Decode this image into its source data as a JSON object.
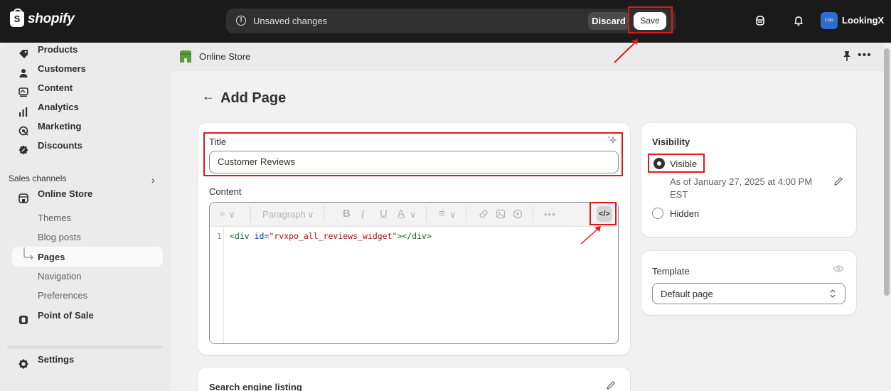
{
  "topbar": {
    "brand": "shopify",
    "brand_glyph": "S",
    "unsaved_icon": "!",
    "unsaved_text": "Unsaved changes",
    "discard_label": "Discard",
    "save_label": "Save",
    "user_initials": "Loo",
    "user_name": "LookingX"
  },
  "sidebar": {
    "items": [
      {
        "label": "Products",
        "icon": "tag-icon"
      },
      {
        "label": "Customers",
        "icon": "person-icon"
      },
      {
        "label": "Content",
        "icon": "content-icon"
      },
      {
        "label": "Analytics",
        "icon": "bar-chart-icon"
      },
      {
        "label": "Marketing",
        "icon": "target-icon"
      },
      {
        "label": "Discounts",
        "icon": "discount-icon"
      }
    ],
    "sales_channels_title": "Sales channels",
    "online_store": {
      "label": "Online Store",
      "icon": "store-icon"
    },
    "sub_items": [
      "Themes",
      "Blog posts",
      "Pages",
      "Navigation",
      "Preferences"
    ],
    "point_of_sale": {
      "label": "Point of Sale",
      "icon": "pos-icon"
    },
    "settings": {
      "label": "Settings",
      "icon": "gear-icon"
    }
  },
  "header": {
    "store_name": "Online Store"
  },
  "page": {
    "title": "Add Page"
  },
  "content_card": {
    "title_label": "Title",
    "title_value": "Customer Reviews",
    "content_label": "Content",
    "paragraph_label": "Paragraph",
    "line_number": "1",
    "code": {
      "open": "<div ",
      "attr": "id",
      "eq": "=",
      "value": "\"rvxpo_all_reviews_widget\"",
      "close": "></div>"
    },
    "code_toggle": "</>"
  },
  "visibility_card": {
    "title": "Visibility",
    "visible_label": "Visible",
    "visible_date": "As of January 27, 2025 at 4:00 PM",
    "visible_tz": "EST",
    "hidden_label": "Hidden"
  },
  "template_card": {
    "title": "Template",
    "selected": "Default page"
  },
  "seo_card": {
    "title": "Search engine listing"
  },
  "colors": {
    "topbar": "#1a1a1a",
    "highlight": "#e0191b",
    "avatar": "#2c6ecb"
  }
}
